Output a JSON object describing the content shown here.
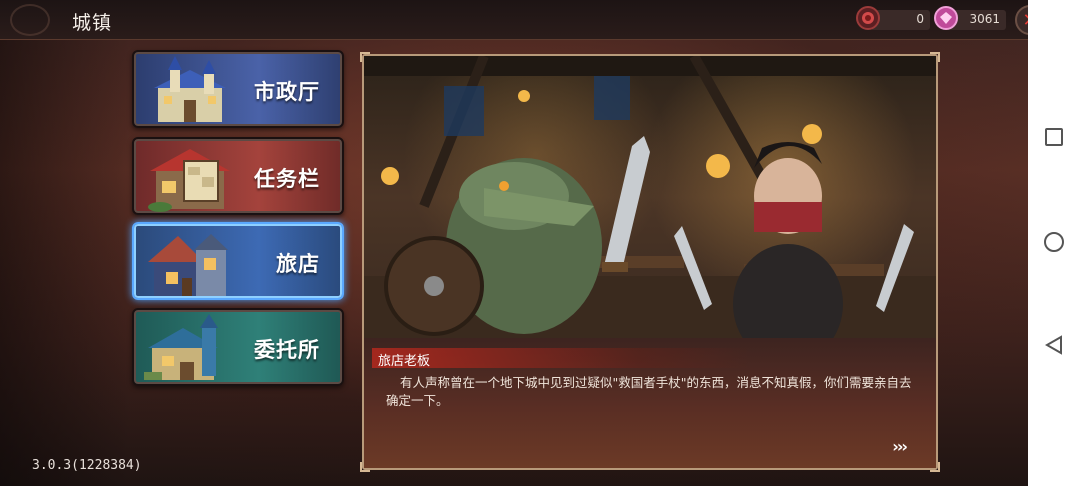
{
  "header": {
    "title": "城镇",
    "resource_1_icon": "rose-emblem-icon",
    "resource_1_value": "0",
    "resource_2_icon": "gem-currency-icon",
    "resource_2_value": "3061",
    "close_icon": "close-icon"
  },
  "menu": {
    "items": [
      {
        "label": "市政厅",
        "icon": "cityhall-building-icon"
      },
      {
        "label": "任务栏",
        "icon": "quest-board-building-icon"
      },
      {
        "label": "旅店",
        "icon": "inn-building-icon",
        "selected": true
      },
      {
        "label": "委托所",
        "icon": "commission-building-icon"
      }
    ]
  },
  "dialog": {
    "speaker": "旅店老板",
    "text": "有人声称曾在一个地下城中见到过疑似\"救国者手杖\"的东西，消息不知真假，你们需要亲自去确定一下。",
    "next_label": "›››"
  },
  "footer": {
    "version": "3.0.3(1228384)"
  },
  "colors": {
    "selected_border": "#5aa8ff",
    "speaker_bar": "#b42820",
    "close_x": "#e23b34"
  }
}
